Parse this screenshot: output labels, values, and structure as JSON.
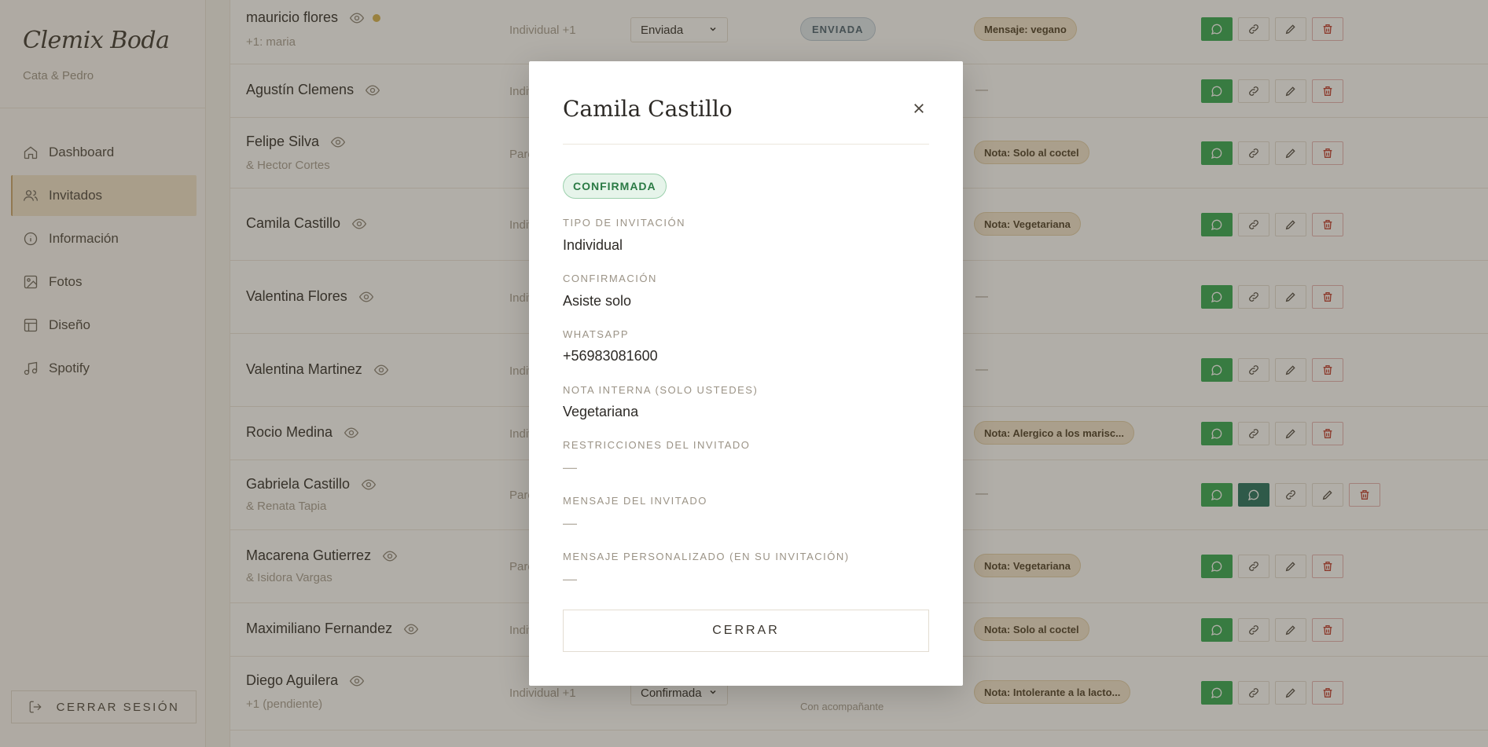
{
  "sidebar": {
    "brand": "Clemix Boda",
    "couple": "Cata & Pedro",
    "items": [
      {
        "label": "Dashboard",
        "icon": "home-icon"
      },
      {
        "label": "Invitados",
        "icon": "users-icon",
        "active": true
      },
      {
        "label": "Información",
        "icon": "info-icon"
      },
      {
        "label": "Fotos",
        "icon": "image-icon"
      },
      {
        "label": "Diseño",
        "icon": "layout-icon"
      },
      {
        "label": "Spotify",
        "icon": "music-icon"
      }
    ],
    "logout_label": "CERRAR SESIÓN"
  },
  "guests": [
    {
      "name": "mauricio flores",
      "sub": "+1: maria",
      "type": "Individual +1",
      "select": "Enviada",
      "status": "ENVIADA",
      "note": "Mensaje: vegano"
    },
    {
      "name": "Agustín Clemens",
      "sub": "",
      "type": "Indiv",
      "select": "",
      "status": "",
      "note": ""
    },
    {
      "name": "Felipe Silva",
      "sub": "& Hector Cortes",
      "type": "Pare",
      "select": "",
      "status": "",
      "note": "Nota: Solo al coctel"
    },
    {
      "name": "Camila Castillo",
      "sub": "",
      "type": "Indiv",
      "select": "",
      "status": "",
      "note": "Nota: Vegetariana"
    },
    {
      "name": "Valentina Flores",
      "sub": "",
      "type": "Indiv",
      "select": "",
      "status": "",
      "note": ""
    },
    {
      "name": "Valentina Martinez",
      "sub": "",
      "type": "Indiv",
      "select": "",
      "status": "",
      "note": ""
    },
    {
      "name": "Rocio Medina",
      "sub": "",
      "type": "Indiv",
      "select": "",
      "status": "",
      "note": "Nota: Alergico a los marisc..."
    },
    {
      "name": "Gabriela Castillo",
      "sub": "& Renata Tapia",
      "type": "Pare",
      "select": "",
      "status": "",
      "note": ""
    },
    {
      "name": "Macarena Gutierrez",
      "sub": "& Isidora Vargas",
      "type": "Pare",
      "select": "",
      "status": "",
      "note": "Nota: Vegetariana"
    },
    {
      "name": "Maximiliano Fernandez",
      "sub": "",
      "type": "Indiv",
      "select": "",
      "status": "",
      "note": "Nota: Solo al coctel"
    },
    {
      "name": "Diego Aguilera",
      "sub": "+1 (pendiente)",
      "type": "Individual +1",
      "select": "Confirmada",
      "status": "",
      "status_sub": "Con acompañante",
      "note": "Nota: Intolerante a la lacto..."
    }
  ],
  "empty_dash": "—",
  "modal": {
    "title": "Camila Castillo",
    "status": "CONFIRMADA",
    "fields": [
      {
        "label": "TIPO DE INVITACIÓN",
        "value": "Individual"
      },
      {
        "label": "CONFIRMACIÓN",
        "value": "Asiste solo"
      },
      {
        "label": "WHATSAPP",
        "value": "+56983081600"
      },
      {
        "label": "NOTA INTERNA (SOLO USTEDES)",
        "value": "Vegetariana"
      },
      {
        "label": "RESTRICCIONES DEL INVITADO",
        "value": "—"
      },
      {
        "label": "MENSAJE DEL INVITADO",
        "value": "—"
      },
      {
        "label": "MENSAJE PERSONALIZADO (EN SU INVITACIÓN)",
        "value": "—"
      }
    ],
    "close_label": "CERRAR"
  },
  "colors": {
    "whatsapp": "#2fa84f",
    "accent": "#c9a26a",
    "confirm": "#2a7a44"
  }
}
